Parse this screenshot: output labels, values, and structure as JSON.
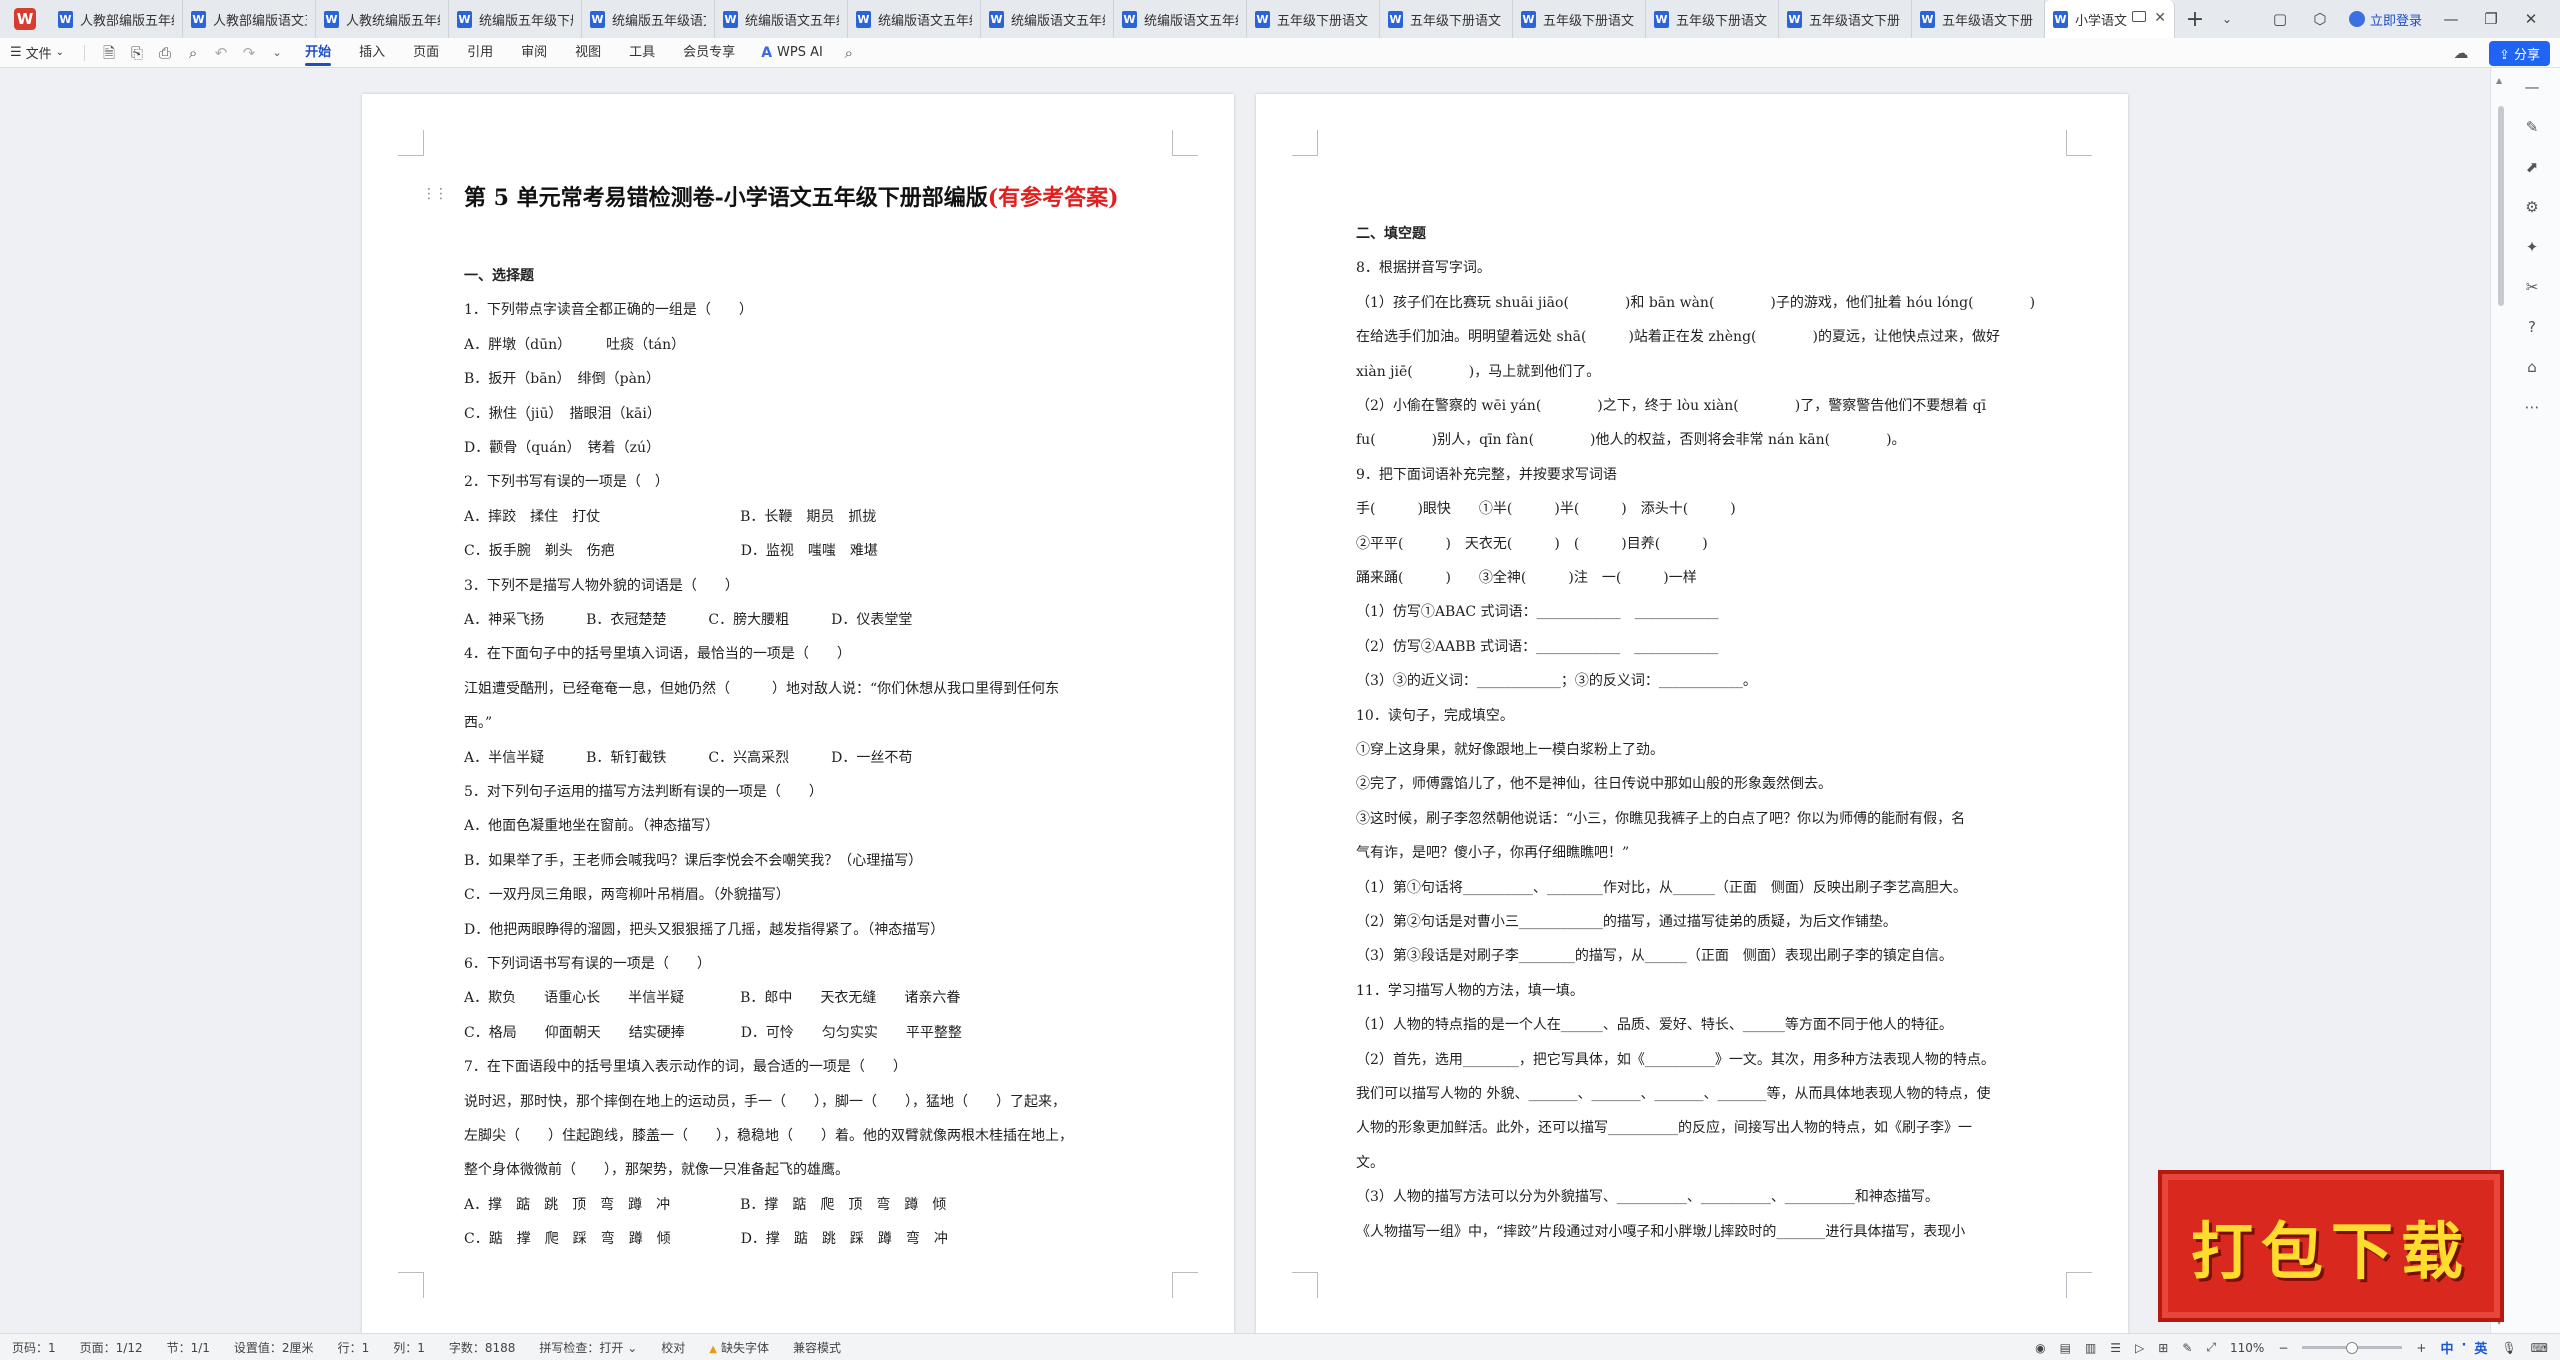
{
  "tabs": [
    {
      "label": "人教部编版五年级"
    },
    {
      "label": "人教部编版语文五"
    },
    {
      "label": "人教统编版五年级"
    },
    {
      "label": "统编版五年级下册"
    },
    {
      "label": "统编版五年级语文"
    },
    {
      "label": "统编版语文五年级"
    },
    {
      "label": "统编版语文五年级"
    },
    {
      "label": "统编版语文五年级"
    },
    {
      "label": "统编版语文五年级"
    },
    {
      "label": "五年级下册语文"
    },
    {
      "label": "五年级下册语文"
    },
    {
      "label": "五年级下册语文"
    },
    {
      "label": "五年级下册语文"
    },
    {
      "label": "五年级语文下册"
    },
    {
      "label": "五年级语文下册"
    },
    {
      "label": "小学语文"
    }
  ],
  "window": {
    "login": "立即登录"
  },
  "menu": {
    "file": "文件",
    "ribbon": [
      "开始",
      "插入",
      "页面",
      "引用",
      "审阅",
      "视图",
      "工具",
      "会员专享"
    ],
    "ai": "WPS AI",
    "share": "分享"
  },
  "doc": {
    "title_main": "第 5 单元常考易错检测卷-小学语文五年级下册部编版",
    "title_red": "(有参考答案)",
    "page1": [
      "一、选择题",
      "1．下列带点字读音全都正确的一组是（　　）",
      "A．胖墩（dūn）　　　吐痰（tán）",
      "B．扳开（bān）　绯倒（pàn）",
      "C．揪住（jiū）　揩眼泪（kāi）",
      "D．颧骨（quán）　铐着（zú）",
      "2．下列书写有误的一项是（　）",
      "A．摔跤　揉住　打仗　　　　　　　　　　B．长鞭　期员　抓拢",
      "C．扳手腕　剃头　伤疤　　　　　　　　　D．监视　嗤嗤　难堪",
      "3．下列不是描写人物外貌的词语是（　　）",
      "A．神采飞扬　　　B．衣冠楚楚　　　C．膀大腰粗　　　D．仪表堂堂",
      "4．在下面句子中的括号里填入词语，最恰当的一项是（　　）",
      "江姐遭受酷刑，已经奄奄一息，但她仍然（　　　）地对敌人说：“你们休想从我口里得到任何东",
      "西。”",
      "A．半信半疑　　　B．斩钉截铁　　　C．兴高采烈　　　D．一丝不苟",
      "5．对下列句子运用的描写方法判断有误的一项是（　　）",
      "A．他面色凝重地坐在窗前。（神态描写）",
      "B．如果举了手，王老师会喊我吗？课后李悦会不会嘲笑我？（心理描写）",
      "C．一双丹凤三角眼，两弯柳叶吊梢眉。（外貌描写）",
      "D．他把两眼睁得的溜圆，把头又狠狠摇了几摇，越发指得紧了。（神态描写）",
      "6．下列词语书写有误的一项是（　　）",
      "A．欺负　　语重心长　　半信半疑　　　　B．郎中　　天衣无缝　　诸亲六眷",
      "C．格局　　仰面朝天　　结实硬捧　　　　D．可怜　　匀匀实实　　平平整整",
      "7．在下面语段中的括号里填入表示动作的词，最合适的一项是（　　）",
      "说时迟，那时快，那个摔倒在地上的运动员，手一（　　），脚一（　　），猛地（　　）了起来，",
      "左脚尖（　　）住起跑线，膝盖一（　　），稳稳地（　　）着。他的双臂就像两根木桂插在地上，",
      "整个身体微微前（　　），那架势，就像一只准备起飞的雄鹰。",
      "A．撑　踮　跳　顶　弯　蹲　冲　　　　　B．撑　踮　爬　顶　弯　蹲　倾",
      "C．踮　撑　爬　踩　弯　蹲　倾　　　　　D．撑　踮　跳　踩　蹲　弯　冲"
    ],
    "page2": [
      "二、填空题",
      "8．根据拼音写字词。",
      "（1）孩子们在比赛玩 shuāi jiāo(　　　　)和 bān wàn(　　　　)子的游戏，他们扯着 hóu lóng(　　　　)",
      "在给选手们加油。明明望着远处 shā(　　　)站着正在发 zhèng(　　　　)的夏远，让他快点过来，做好",
      "xiàn jiē(　　　　)，马上就到他们了。",
      "（2）小偷在警察的 wēi yán(　　　　)之下，终于 lòu xiàn(　　　　)了，警察警告他们不要想着 qī",
      "fu(　　　　)别人，qīn fàn(　　　　)他人的权益，否则将会非常 nán kān(　　　　)。",
      "9．把下面词语补充完整，并按要求写词语",
      "手(　　　)眼快　　①半(　　　)半(　　　)　添头十(　　　)",
      "②平平(　　　)　天衣无(　　　)　(　　　)目养(　　　)",
      "踊来踊(　　　)　　③全神(　　　)注　一(　　　)一样",
      "（1）仿写①ABAC 式词语：____________　____________",
      "（2）仿写②AABB 式词语：____________　____________",
      "（3）③的近义词：____________；③的反义词：____________。",
      "10．读句子，完成填空。",
      "①穿上这身果，就好像跟地上一模白浆粉上了劲。",
      "②完了，师傅露馅儿了，他不是神仙，往日传说中那如山般的形象轰然倒去。",
      "③这时候，刷子李忽然朝他说话：“小三，你瞧见我裤子上的白点了吧？你以为师傅的能耐有假，名",
      "气有诈，是吧？傻小子，你再仔细瞧瞧吧！”",
      "（1）第①句话将__________、________作对比，从______（正面　侧面）反映出刷子李艺高胆大。",
      "（2）第②句话是对曹小三____________的描写，通过描写徒弟的质疑，为后文作铺垫。",
      "（3）第③段话是对刷子李________的描写，从______（正面　侧面）表现出刷子李的镇定自信。",
      "11．学习描写人物的方法，填一填。",
      "（1）人物的特点指的是一个人在______、品质、爱好、特长、______等方面不同于他人的特征。",
      "（2）首先，选用________，把它写具体，如《__________》一文。其次，用多种方法表现人物的特点。",
      "我们可以描写人物的 外貌、_______、_______、_______、_______等，从而具体地表现人物的特点，使",
      "人物的形象更加鲜活。此外，还可以描写__________的反应，间接写出人物的特点，如《刷子李》一",
      "文。",
      "（3）人物的描写方法可以分为外貌描写、__________、__________、__________和神态描写。",
      "《人物描写一组》中，“摔跤”片段通过对小嘎子和小胖墩儿摔跤时的_______进行具体描写，表现小"
    ]
  },
  "status": {
    "page": "页码：1",
    "pages": "页面：1/12",
    "section": "节：1/1",
    "setting": "设置值：2厘米",
    "row": "行：1",
    "col": "列：1",
    "words": "字数：8188",
    "spell": "拼写检查：打开",
    "proof": "校对",
    "font_missing": "缺失字体",
    "compat": "兼容模式",
    "zoom": "110%",
    "ime": [
      "中",
      "·",
      "英"
    ]
  },
  "promo": {
    "text": "打包下载"
  }
}
